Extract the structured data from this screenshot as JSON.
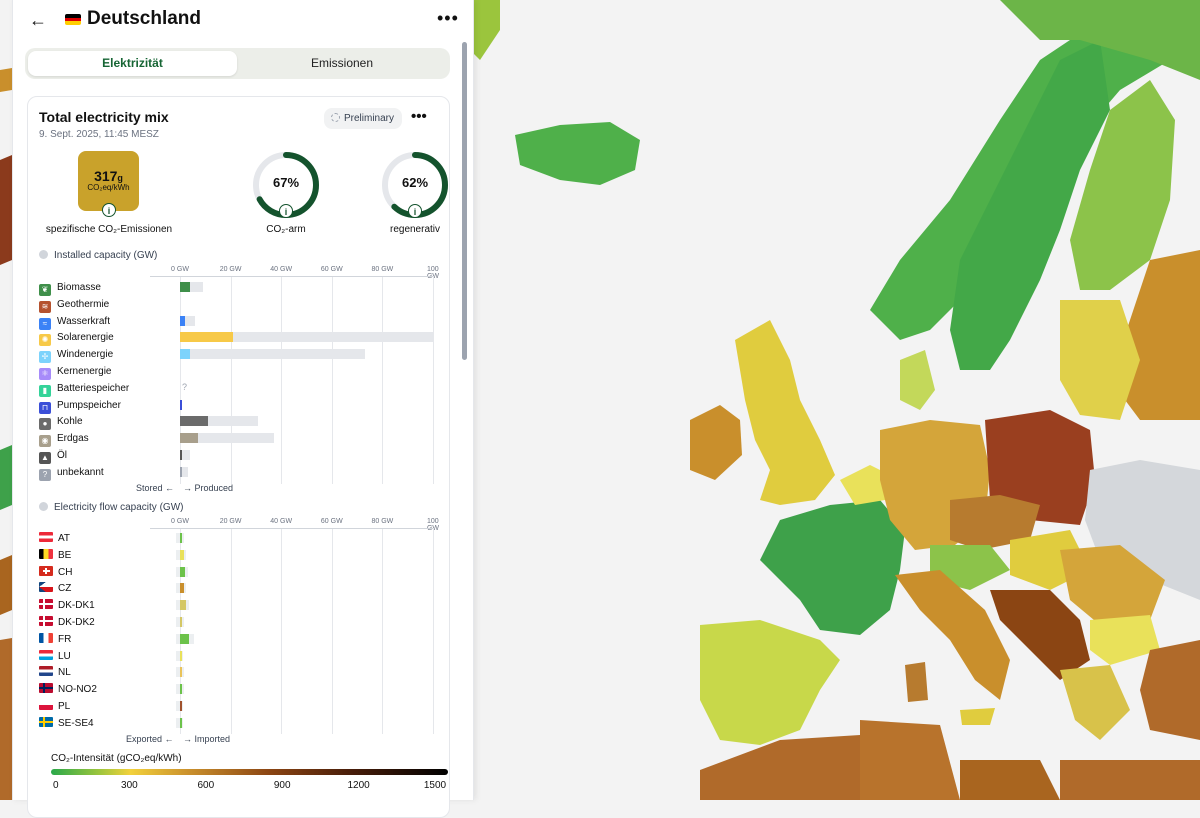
{
  "header": {
    "title": "Deutschland",
    "more": "•••"
  },
  "tabs": {
    "electricity": "Elektrizität",
    "emissions": "Emissionen"
  },
  "card": {
    "title": "Total electricity mix",
    "date": "9. Sept. 2025, 11:45 MESZ",
    "preliminary": "Preliminary",
    "more": "•••",
    "co2_value": "317",
    "co2_value_suffix": "g",
    "co2_unit": "CO₂eq/kWh",
    "co2_label": "spezifische CO₂-Emissionen",
    "lowcarbon_pct": "67%",
    "lowcarbon_label": "CO₂-arm",
    "renewable_pct": "62%",
    "renewable_label": "regenerativ",
    "lowcarbon_fraction": 0.67,
    "renewable_fraction": 0.62
  },
  "installed": {
    "heading": "Installed capacity (GW)",
    "ticks": [
      "0 GW",
      "20 GW",
      "40 GW",
      "60 GW",
      "80 GW",
      "100 GW"
    ],
    "max": 100,
    "rows": [
      {
        "label": "Biomasse",
        "icon": "plant-icon",
        "color": "#3f8f4a",
        "produced": 4,
        "capacity": 9
      },
      {
        "label": "Geothermie",
        "icon": "heat-icon",
        "color": "#b5522f",
        "produced": 0,
        "capacity": 0
      },
      {
        "label": "Wasserkraft",
        "icon": "water-icon",
        "color": "#3b82f6",
        "produced": 2,
        "capacity": 6
      },
      {
        "label": "Solarenergie",
        "icon": "sun-icon",
        "color": "#f7c948",
        "produced": 21,
        "capacity": 100
      },
      {
        "label": "Windenergie",
        "icon": "wind-icon",
        "color": "#7dd3fc",
        "produced": 4,
        "capacity": 73
      },
      {
        "label": "Kernenergie",
        "icon": "atom-icon",
        "color": "#a78bfa",
        "produced": 0,
        "capacity": 0
      },
      {
        "label": "Batteriespeicher",
        "icon": "battery-icon",
        "color": "#34d399",
        "produced": 0,
        "capacity": 0,
        "unknown": "?"
      },
      {
        "label": "Pumpspeicher",
        "icon": "pump-icon",
        "color": "#3b4fd8",
        "produced": 0.6,
        "capacity": 0.6
      },
      {
        "label": "Kohle",
        "icon": "coal-icon",
        "color": "#6b6b6b",
        "produced": 11,
        "capacity": 31
      },
      {
        "label": "Erdgas",
        "icon": "gas-icon",
        "color": "#a89f8c",
        "produced": 7,
        "capacity": 37
      },
      {
        "label": "Öl",
        "icon": "oil-icon",
        "color": "#555555",
        "produced": 0.4,
        "capacity": 4
      },
      {
        "label": "unbekannt",
        "icon": "unknown-icon",
        "color": "#9ca3af",
        "produced": 0.5,
        "capacity": 3
      }
    ],
    "footer_left": "Stored ←",
    "footer_right": "→ Produced"
  },
  "flows": {
    "heading": "Electricity flow capacity (GW)",
    "ticks": [
      "0 GW",
      "20 GW",
      "40 GW",
      "60 GW",
      "80 GW",
      "100 GW"
    ],
    "rows": [
      {
        "label": "AT",
        "flag": "at-flag",
        "value": 0.5,
        "color": "#6cc24a"
      },
      {
        "label": "BE",
        "flag": "be-flag",
        "value": 1,
        "color": "#e9e15a"
      },
      {
        "label": "CH",
        "flag": "ch-flag",
        "value": 1.4,
        "color": "#6cc24a"
      },
      {
        "label": "CZ",
        "flag": "cz-flag",
        "value": 1,
        "color": "#c98f2c"
      },
      {
        "label": "DK-DK1",
        "flag": "dk-flag",
        "value": 1.5,
        "color": "#d4c765"
      },
      {
        "label": "DK-DK2",
        "flag": "dk-flag",
        "value": 0.5,
        "color": "#d4c765"
      },
      {
        "label": "FR",
        "flag": "fr-flag",
        "value": 2.5,
        "color": "#6cc24a"
      },
      {
        "label": "LU",
        "flag": "lu-flag",
        "value": 0.3,
        "color": "#e9e15a"
      },
      {
        "label": "NL",
        "flag": "nl-flag",
        "value": 0.5,
        "color": "#e9c35a"
      },
      {
        "label": "NO-NO2",
        "flag": "no-flag",
        "value": 0.6,
        "color": "#6cc24a"
      },
      {
        "label": "PL",
        "flag": "pl-flag",
        "value": 0.4,
        "color": "#a0522d"
      },
      {
        "label": "SE-SE4",
        "flag": "se-flag",
        "value": 0.4,
        "color": "#6cc24a"
      }
    ],
    "footer_left": "Exported ←",
    "footer_right": "→ Imported"
  },
  "legend": {
    "title": "CO₂-Intensität (gCO₂eq/kWh)",
    "ticks": [
      "0",
      "300",
      "600",
      "900",
      "1200",
      "1500"
    ]
  },
  "colors": {
    "accent": "#166534",
    "panel_bg": "#ffffff",
    "map_sea": "#f3f3f3"
  }
}
